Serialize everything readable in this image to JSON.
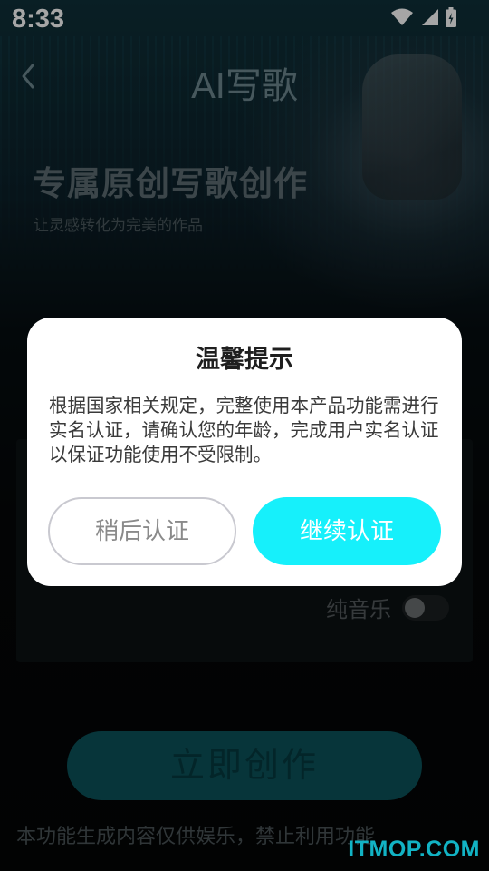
{
  "status_bar": {
    "time": "8:33",
    "icons": [
      "wifi-icon",
      "cellular-icon",
      "battery-icon"
    ]
  },
  "header": {
    "title": "AI写歌",
    "back_icon": "chevron-left-icon"
  },
  "hero": {
    "title": "专属原创写歌创作",
    "subtitle": "让灵感转化为完美的作品"
  },
  "form": {
    "pure_music_label": "纯音乐",
    "pure_music_on": false
  },
  "create_button": {
    "label": "立即创作"
  },
  "disclaimer": "本功能生成内容仅供娱乐，禁止利用功能",
  "watermark": "ITMOP.COM",
  "dialog": {
    "title": "温馨提示",
    "body": "根据国家相关规定，完整使用本产品功能需进行实名认证，请确认您的年龄，完成用户实名认证以保证功能使用不受限制。",
    "later_label": "稍后认证",
    "continue_label": "继续认证"
  },
  "colors": {
    "accent": "#16f0fb",
    "dialog_bg": "#ffffff",
    "screen_bg": "#060d10"
  }
}
